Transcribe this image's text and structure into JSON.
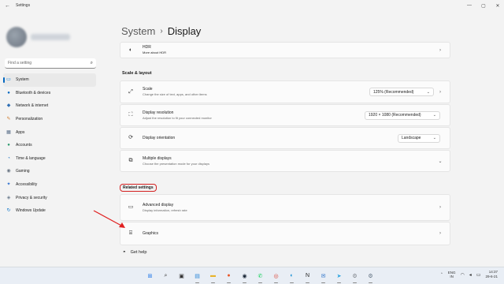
{
  "window": {
    "title": "Settings",
    "back_glyph": "←",
    "controls": [
      "—",
      "▢",
      "✕"
    ]
  },
  "sidebar": {
    "search_placeholder": "Find a setting",
    "items": [
      {
        "label": "System",
        "icon": "system-icon",
        "glyph": "▭",
        "color": "#0078d4",
        "active": true
      },
      {
        "label": "Bluetooth & devices",
        "icon": "bluetooth-icon",
        "glyph": "●",
        "color": "#0067c0"
      },
      {
        "label": "Network & internet",
        "icon": "network-icon",
        "glyph": "◆",
        "color": "#2f6fb5"
      },
      {
        "label": "Personalization",
        "icon": "personalization-icon",
        "glyph": "✎",
        "color": "#d07a2b"
      },
      {
        "label": "Apps",
        "icon": "apps-icon",
        "glyph": "▦",
        "color": "#5a6f8a"
      },
      {
        "label": "Accounts",
        "icon": "accounts-icon",
        "glyph": "●",
        "color": "#2e9b6e"
      },
      {
        "label": "Time & language",
        "icon": "time-language-icon",
        "glyph": "◔",
        "color": "#2778c4"
      },
      {
        "label": "Gaming",
        "icon": "gaming-icon",
        "glyph": "◉",
        "color": "#6b7785"
      },
      {
        "label": "Accessibility",
        "icon": "accessibility-icon",
        "glyph": "✦",
        "color": "#2d6fd0"
      },
      {
        "label": "Privacy & security",
        "icon": "shield-icon",
        "glyph": "◈",
        "color": "#6d7d8f"
      },
      {
        "label": "Windows Update",
        "icon": "windows-update-icon",
        "glyph": "↻",
        "color": "#0a73c8"
      }
    ]
  },
  "main": {
    "breadcrumb": {
      "parent": "System",
      "separator": "›",
      "current": "Display"
    },
    "hdr": {
      "title": "HDR",
      "subtitle": "More about HDR"
    },
    "scale_layout_heading": "Scale & layout",
    "scale": {
      "title": "Scale",
      "subtitle": "Change the size of text, apps, and other items",
      "value": "125% (Recommended)"
    },
    "resolution": {
      "title": "Display resolution",
      "subtitle": "Adjust the resolution to fit your connected monitor",
      "value": "1920 × 1080 (Recommended)"
    },
    "orientation": {
      "title": "Display orientation",
      "value": "Landscape"
    },
    "multiple": {
      "title": "Multiple displays",
      "subtitle": "Choose the presentation mode for your displays"
    },
    "related_heading": "Related settings",
    "advanced": {
      "title": "Advanced display",
      "subtitle": "Display information, refresh rate"
    },
    "graphics": {
      "title": "Graphics"
    },
    "get_help": "Get help"
  },
  "taskbar": {
    "apps": [
      {
        "icon": "windows-start-icon",
        "glyph": "⊞",
        "color": "#1a73e8"
      },
      {
        "icon": "search-icon",
        "glyph": "⌕",
        "color": "#333333"
      },
      {
        "icon": "task-view-icon",
        "glyph": "▣",
        "color": "#333333"
      },
      {
        "icon": "widgets-icon",
        "glyph": "▤",
        "color": "#2b88d8"
      },
      {
        "icon": "file-explorer-icon",
        "glyph": "▬",
        "color": "#e8b32c"
      },
      {
        "icon": "firefox-icon",
        "glyph": "●",
        "color": "#e8582a"
      },
      {
        "icon": "steam-icon",
        "glyph": "◉",
        "color": "#1b2838"
      },
      {
        "icon": "whatsapp-icon",
        "glyph": "✆",
        "color": "#25d366"
      },
      {
        "icon": "chrome-icon",
        "glyph": "◎",
        "color": "#db4437"
      },
      {
        "icon": "edge-icon",
        "glyph": "◐",
        "color": "#0f8bd3"
      },
      {
        "icon": "notion-icon",
        "glyph": "N",
        "color": "#222222"
      },
      {
        "icon": "mail-icon",
        "glyph": "✉",
        "color": "#2a71c8"
      },
      {
        "icon": "telegram-icon",
        "glyph": "➤",
        "color": "#2aa3df"
      },
      {
        "icon": "gear-icon",
        "glyph": "⚙",
        "color": "#7a7f86"
      },
      {
        "icon": "settings-app-icon",
        "glyph": "⚙",
        "color": "#5b6b7c"
      }
    ],
    "tray": {
      "chevron": "⌃",
      "lang_top": "ENG",
      "lang_bottom": "IN",
      "time": "14:37",
      "date": "29-6-21"
    }
  }
}
